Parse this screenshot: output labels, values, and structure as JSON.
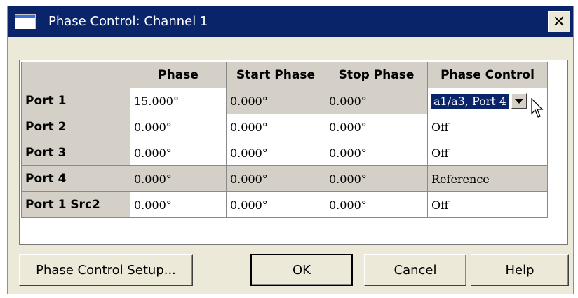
{
  "window": {
    "title": "Phase Control: Channel 1",
    "close_glyph": "✕"
  },
  "table": {
    "columns": [
      "",
      "Phase",
      "Start Phase",
      "Stop Phase",
      "Phase Control"
    ],
    "rows": [
      {
        "port": "Port 1",
        "phase": "15.000°",
        "start": "0.000°",
        "stop": "0.000°",
        "control": "a1/a3, Port 4"
      },
      {
        "port": "Port 2",
        "phase": "0.000°",
        "start": "0.000°",
        "stop": "0.000°",
        "control": "Off"
      },
      {
        "port": "Port 3",
        "phase": "0.000°",
        "start": "0.000°",
        "stop": "0.000°",
        "control": "Off"
      },
      {
        "port": "Port 4",
        "phase": "0.000°",
        "start": "0.000°",
        "stop": "0.000°",
        "control": "Reference"
      },
      {
        "port": "Port 1 Src2",
        "phase": "0.000°",
        "start": "0.000°",
        "stop": "0.000°",
        "control": "Off"
      }
    ]
  },
  "buttons": {
    "setup": "Phase Control Setup...",
    "ok": "OK",
    "cancel": "Cancel",
    "help": "Help"
  },
  "icons": {
    "window_icon": "window-icon",
    "close": "close-icon",
    "dropdown": "chevron-down-icon",
    "cursor": "mouse-cursor-icon"
  },
  "colors": {
    "titlebar": "#0a246a",
    "dialog_bg": "#ece9d8",
    "readonly_cell": "#d4d0c8",
    "selection": "#0a246a"
  }
}
